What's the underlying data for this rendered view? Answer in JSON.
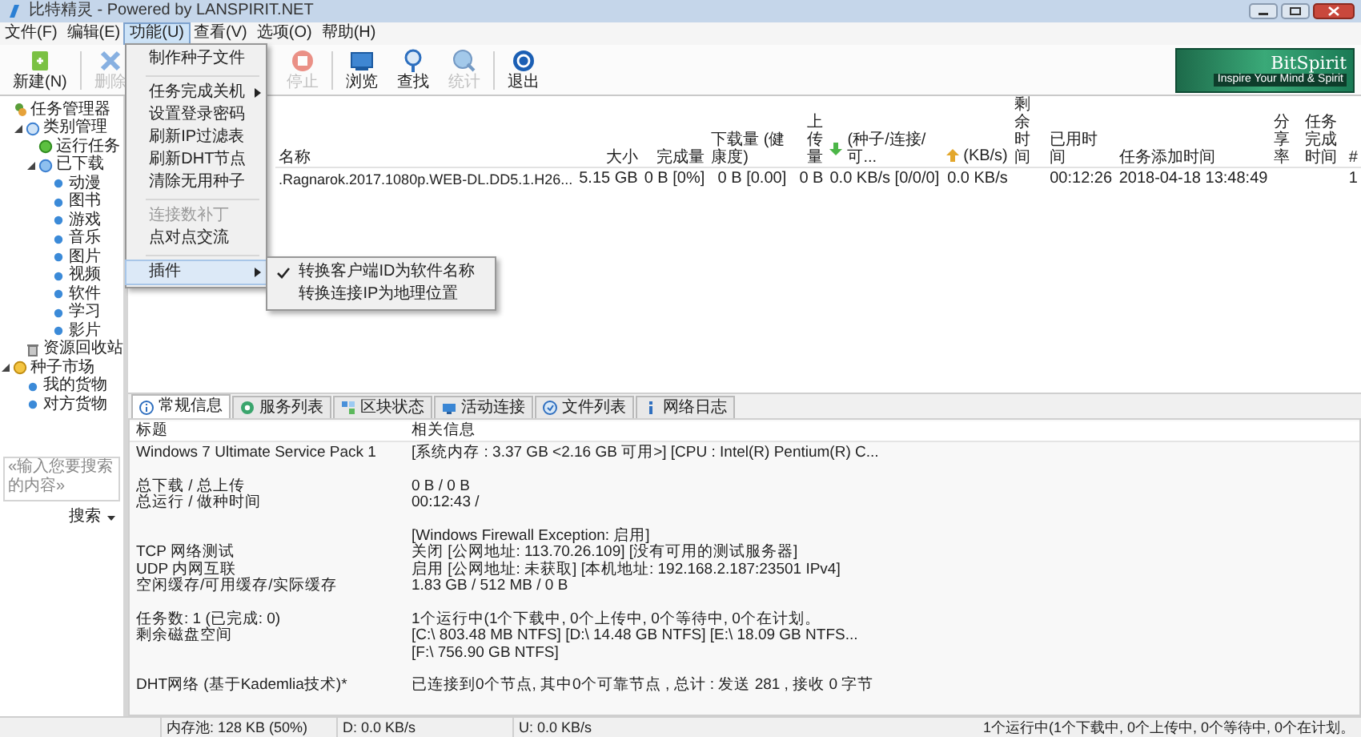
{
  "window": {
    "title": "比特精灵 - Powered by LANSPIRIT.NET"
  },
  "menu_bar": [
    {
      "label": "文件(F)",
      "selected": false
    },
    {
      "label": "编辑(E)",
      "selected": false
    },
    {
      "label": "功能(U)",
      "selected": true
    },
    {
      "label": "查看(V)",
      "selected": false
    },
    {
      "label": "选项(O)",
      "selected": false
    },
    {
      "label": "帮助(H)",
      "selected": false
    }
  ],
  "open_menu": {
    "items": [
      {
        "kind": "item",
        "label": "制作种子文件",
        "disabled": false
      },
      {
        "kind": "separator"
      },
      {
        "kind": "submenu",
        "label": "任务完成关机",
        "disabled": false
      },
      {
        "kind": "item",
        "label": "设置登录密码",
        "disabled": false
      },
      {
        "kind": "item",
        "label": "刷新IP过滤表",
        "disabled": false
      },
      {
        "kind": "item",
        "label": "刷新DHT节点",
        "disabled": false
      },
      {
        "kind": "item",
        "label": "清除无用种子",
        "disabled": false
      },
      {
        "kind": "separator"
      },
      {
        "kind": "item",
        "label": "连接数补丁",
        "disabled": true
      },
      {
        "kind": "item",
        "label": "点对点交流",
        "disabled": false
      },
      {
        "kind": "separator"
      },
      {
        "kind": "submenu",
        "label": "插件",
        "disabled": false,
        "selected": true,
        "open": true
      }
    ],
    "submenu": [
      {
        "label": "转换客户端ID为软件名称",
        "checked": true
      },
      {
        "label": "转换连接IP为地理位置",
        "checked": false
      }
    ]
  },
  "toolbar": [
    {
      "label": "新建(N)",
      "disabled": false
    },
    {
      "label": "删除",
      "disabled": true
    },
    {
      "label": "停止",
      "disabled": true
    },
    {
      "label": "浏览",
      "disabled": false
    },
    {
      "label": "查找",
      "disabled": false
    },
    {
      "label": "统计",
      "disabled": true
    },
    {
      "label": "退出",
      "disabled": false
    }
  ],
  "logo": {
    "name": "BitSpirit",
    "slogan": "Inspire Your Mind & Spirit"
  },
  "tree": [
    {
      "label": "任务管理器",
      "kind": "manager",
      "expanded": true,
      "children": [
        {
          "label": "类别管理",
          "kind": "group",
          "expanded": true,
          "children": [
            {
              "label": "运行任务",
              "kind": "running"
            },
            {
              "label": "已下载",
              "kind": "folder",
              "expanded": true,
              "children": [
                {
                  "label": "动漫",
                  "kind": "leaf"
                },
                {
                  "label": "图书",
                  "kind": "leaf"
                },
                {
                  "label": "游戏",
                  "kind": "leaf"
                },
                {
                  "label": "音乐",
                  "kind": "leaf"
                },
                {
                  "label": "图片",
                  "kind": "leaf"
                },
                {
                  "label": "视频",
                  "kind": "leaf"
                },
                {
                  "label": "软件",
                  "kind": "leaf"
                },
                {
                  "label": "学习",
                  "kind": "leaf"
                },
                {
                  "label": "影片",
                  "kind": "leaf"
                }
              ]
            }
          ]
        },
        {
          "label": "资源回收站",
          "kind": "bin"
        }
      ]
    },
    {
      "label": "种子市场",
      "kind": "market",
      "expanded": true,
      "children": [
        {
          "label": "我的货物",
          "kind": "leaf"
        },
        {
          "label": "对方货物",
          "kind": "leaf"
        }
      ]
    }
  ],
  "search": {
    "placeholder": "«输入您要搜索的内容»",
    "button": "搜索"
  },
  "task_list": {
    "columns": [
      {
        "label": "名称",
        "kind": "text"
      },
      {
        "label": "大小",
        "kind": "text"
      },
      {
        "label": "完成量",
        "kind": "text"
      },
      {
        "label": "下载量 (健康度)",
        "kind": "text"
      },
      {
        "label": "上传量",
        "kind": "text"
      },
      {
        "label": "(种子/连接/可...",
        "kind": "download"
      },
      {
        "label": "(KB/s)",
        "kind": "upload"
      },
      {
        "label": "剩余时间",
        "kind": "text"
      },
      {
        "label": "已用时间",
        "kind": "text"
      },
      {
        "label": "任务添加时间",
        "kind": "text"
      },
      {
        "label": "分享率",
        "kind": "text"
      },
      {
        "label": "任务完成时间",
        "kind": "text"
      },
      {
        "label": "#",
        "kind": "text"
      }
    ],
    "rows": [
      {
        "cells": [
          ".Ragnarok.2017.1080p.WEB-DL.DD5.1.H26...",
          "5.15 GB",
          "0 B [0%]",
          "0 B [0.00]",
          "0 B",
          "0.0 KB/s [0/0/0]",
          "0.0 KB/s",
          null,
          "00:12:26",
          "2018-04-18 13:48:49",
          null,
          null,
          "1"
        ]
      }
    ]
  },
  "detail_tabs": [
    {
      "label": "常规信息",
      "selected": true
    },
    {
      "label": "服务列表",
      "selected": false
    },
    {
      "label": "区块状态",
      "selected": false
    },
    {
      "label": "活动连接",
      "selected": false
    },
    {
      "label": "文件列表",
      "selected": false
    },
    {
      "label": "网络日志",
      "selected": false
    }
  ],
  "info": {
    "columns": [
      "标题",
      "相关信息"
    ],
    "groups": [
      [
        {
          "label": "Windows 7 Ultimate Service Pack 1",
          "value": "[系统内存 : 3.37 GB <2.16 GB 可用>] [CPU : Intel(R) Pentium(R) C..."
        }
      ],
      [
        {
          "label": "总下载 / 总上传",
          "value": "0 B / 0 B"
        },
        {
          "label": "总运行 / 做种时间",
          "value": "00:12:43 /"
        }
      ],
      [
        {
          "value": "[Windows Firewall Exception: 启用]"
        },
        {
          "label": "TCP 网络测试",
          "value": "关闭 [公网地址: 113.70.26.109] [没有可用的测试服务器]"
        },
        {
          "label": "UDP 内网互联",
          "value": "启用 [公网地址: 未获取] [本机地址: 192.168.2.187:23501 IPv4]"
        },
        {
          "label": "空闲缓存/可用缓存/实际缓存",
          "value": "1.83 GB / 512 MB / 0 B"
        }
      ],
      [
        {
          "label": "任务数: 1 (已完成: 0)",
          "value": "1个运行中(1个下载中, 0个上传中, 0个等待中, 0个在计划。"
        },
        {
          "label": "剩余磁盘空间",
          "value": "[C:\\ 803.48 MB  NTFS]  [D:\\ 14.48 GB  NTFS]  [E:\\ 18.09 GB  NTFS..."
        },
        {
          "value": "[F:\\ 756.90 GB  NTFS]"
        }
      ],
      [
        {
          "label": "DHT网络 (基于Kademlia技术)*",
          "value": "已连接到0个节点, 其中0个可靠节点 , 总计 : 发送 281 , 接收 0 字节"
        }
      ]
    ]
  },
  "status_bar": {
    "left": [
      "内存池: 128 KB (50%)",
      "D: 0.0 KB/s",
      "U: 0.0 KB/s"
    ],
    "right": "1个运行中(1个下载中, 0个上传中, 0个等待中, 0个在计划。"
  }
}
